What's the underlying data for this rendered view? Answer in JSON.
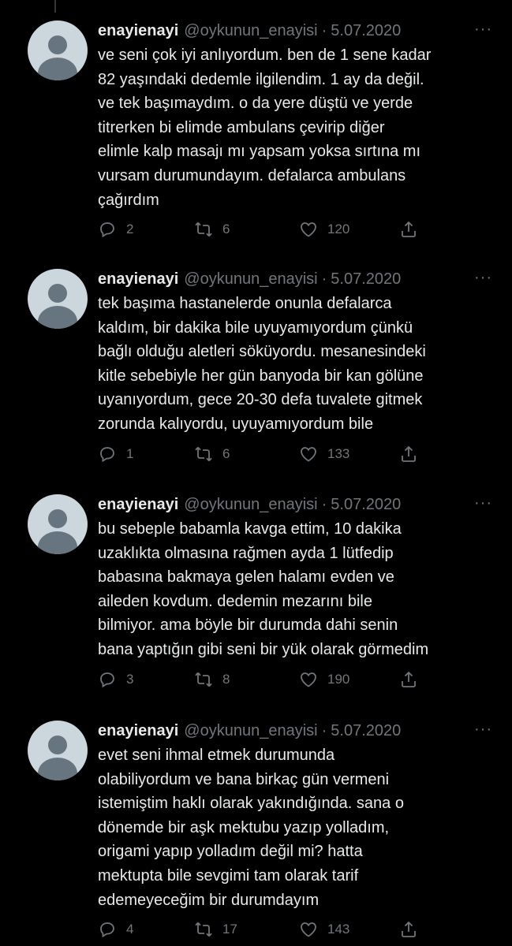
{
  "tweets": [
    {
      "name": "enayienayi",
      "handle": "@oykunun_enayisi",
      "separator": "·",
      "date": "5.07.2020",
      "more": "···",
      "text": "ve seni çok iyi anlıyordum. ben de 1 sene kadar\n82 yaşındaki dedemle ilgilendim. 1 ay da değil.\nve tek başımaydım. o da yere düştü ve yerde\ntitrerken bi elimde ambulans çevirip diğer\nelimle kalp masajı mı yapsam yoksa sırtına mı\nvursam durumundayım. defalarca ambulans\nçağırdım",
      "replies": "2",
      "retweets": "6",
      "likes": "120"
    },
    {
      "name": "enayienayi",
      "handle": "@oykunun_enayisi",
      "separator": "·",
      "date": "5.07.2020",
      "more": "···",
      "text": "tek başıma hastanelerde onunla defalarca\nkaldım, bir dakika bile uyuyamıyordum çünkü\nbağlı olduğu aletleri söküyordu. mesanesindeki\nkitle sebebiyle her gün banyoda bir kan gölüne\nuyanıyordum, gece 20-30 defa tuvalete gitmek\nzorunda kalıyordu, uyuyamıyordum bile",
      "replies": "1",
      "retweets": "6",
      "likes": "133"
    },
    {
      "name": "enayienayi",
      "handle": "@oykunun_enayisi",
      "separator": "·",
      "date": "5.07.2020",
      "more": "···",
      "text": "bu sebeple babamla kavga ettim, 10 dakika\nuzaklıkta olmasına rağmen ayda 1 lütfedip\nbabasına bakmaya gelen halamı evden ve\naileden kovdum. dedemin mezarını bile\nbilmiyor. ama böyle bir durumda dahi senin\nbana yaptığın gibi seni bir yük olarak görmedim",
      "replies": "3",
      "retweets": "8",
      "likes": "190"
    },
    {
      "name": "enayienayi",
      "handle": "@oykunun_enayisi",
      "separator": "·",
      "date": "5.07.2020",
      "more": "···",
      "text": "evet seni ihmal etmek durumunda\nolabiliyordum ve bana birkaç gün vermeni\nistemiştim haklı olarak yakındığında. sana o\ndönemde bir aşk mektubu yazıp yolladım,\norigami yapıp yolladım değil mi? hatta\nmektupta bile sevgimi tam olarak tarif\nedemeyeceğim bir durumdayım",
      "replies": "4",
      "retweets": "17",
      "likes": "143"
    }
  ],
  "icons": {
    "reply": "reply-icon",
    "retweet": "retweet-icon",
    "like": "heart-icon",
    "share": "share-icon"
  },
  "colors": {
    "background": "#000000",
    "text": "#e7e9ea",
    "secondary": "#71767b",
    "avatar_bg": "#ccd6dd",
    "avatar_fg": "#66757f"
  }
}
